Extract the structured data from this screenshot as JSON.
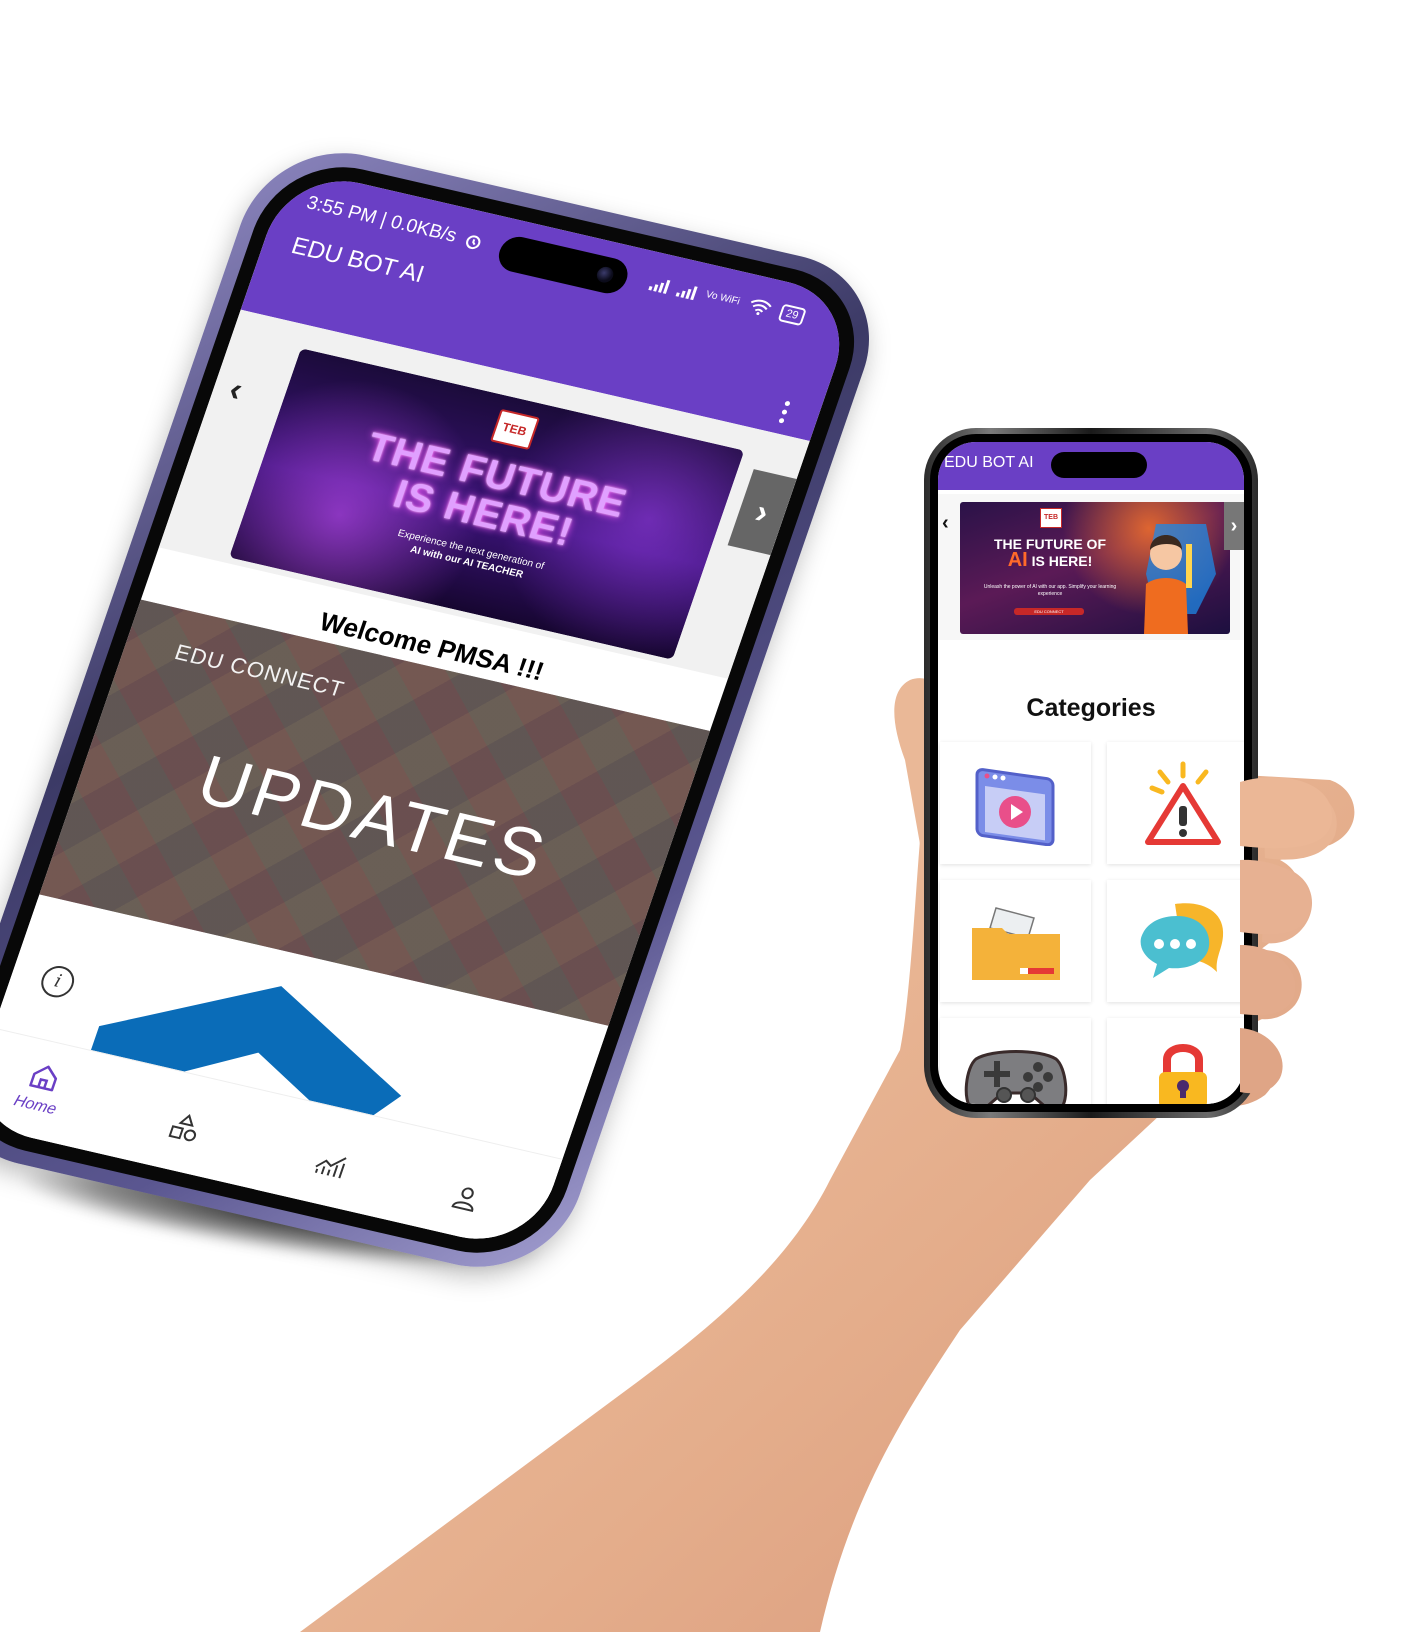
{
  "large_phone": {
    "status_bar": {
      "time": "3:55 PM | 0.0KB/s",
      "network": "Vo WiFi",
      "battery": "29"
    },
    "app_bar": {
      "title": "EDU BOT AI"
    },
    "carousel": {
      "prev_label": "‹",
      "next_label": "›",
      "banner": {
        "logo": "TEB",
        "headline_1": "THE FUTURE",
        "headline_2": "IS HERE!",
        "subtext_1": "Experience the next generation of",
        "subtext_2": "AI with our AI TEACHER"
      }
    },
    "welcome_text": "Welcome PMSA !!!",
    "updates_card": {
      "kicker": "EDU CONNECT",
      "title": "UPDATES"
    },
    "info_icon_glyph": "i",
    "bottom_nav": {
      "items": [
        {
          "label": "Home",
          "icon": "home-icon",
          "active": true
        },
        {
          "label": "",
          "icon": "shapes-icon",
          "active": false
        },
        {
          "label": "",
          "icon": "chart-icon",
          "active": false
        },
        {
          "label": "",
          "icon": "profile-icon",
          "active": false
        }
      ]
    }
  },
  "small_phone": {
    "app_bar": {
      "title": "EDU BOT AI"
    },
    "carousel": {
      "prev_label": "‹",
      "next_label": "›",
      "banner": {
        "logo": "TEB",
        "headline_1": "THE FUTURE OF",
        "headline_ai": "AI",
        "headline_2": "IS HERE!",
        "subtext": "Unleash the power of AI with our app. Simplify your learning experience",
        "button": "EDU CONNECT"
      }
    },
    "section_title": "Categories",
    "categories": [
      {
        "icon": "video-player-icon"
      },
      {
        "icon": "warning-icon"
      },
      {
        "icon": "folder-icon"
      },
      {
        "icon": "chat-bubbles-icon"
      },
      {
        "icon": "gamepad-icon"
      },
      {
        "icon": "lock-icon"
      }
    ]
  },
  "colors": {
    "brand_purple": "#6a3fc5",
    "frame_lavender": "#8c86bf",
    "updates_bg": "#6e6360"
  }
}
